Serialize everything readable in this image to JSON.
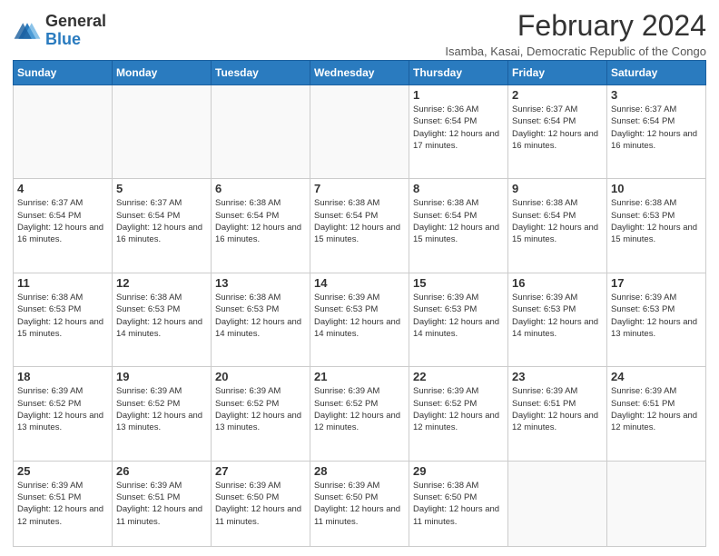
{
  "logo": {
    "general": "General",
    "blue": "Blue"
  },
  "header": {
    "month_year": "February 2024",
    "subtitle": "Isamba, Kasai, Democratic Republic of the Congo"
  },
  "weekdays": [
    "Sunday",
    "Monday",
    "Tuesday",
    "Wednesday",
    "Thursday",
    "Friday",
    "Saturday"
  ],
  "weeks": [
    [
      {
        "day": "",
        "info": ""
      },
      {
        "day": "",
        "info": ""
      },
      {
        "day": "",
        "info": ""
      },
      {
        "day": "",
        "info": ""
      },
      {
        "day": "1",
        "info": "Sunrise: 6:36 AM\nSunset: 6:54 PM\nDaylight: 12 hours and 17 minutes."
      },
      {
        "day": "2",
        "info": "Sunrise: 6:37 AM\nSunset: 6:54 PM\nDaylight: 12 hours and 16 minutes."
      },
      {
        "day": "3",
        "info": "Sunrise: 6:37 AM\nSunset: 6:54 PM\nDaylight: 12 hours and 16 minutes."
      }
    ],
    [
      {
        "day": "4",
        "info": "Sunrise: 6:37 AM\nSunset: 6:54 PM\nDaylight: 12 hours and 16 minutes."
      },
      {
        "day": "5",
        "info": "Sunrise: 6:37 AM\nSunset: 6:54 PM\nDaylight: 12 hours and 16 minutes."
      },
      {
        "day": "6",
        "info": "Sunrise: 6:38 AM\nSunset: 6:54 PM\nDaylight: 12 hours and 16 minutes."
      },
      {
        "day": "7",
        "info": "Sunrise: 6:38 AM\nSunset: 6:54 PM\nDaylight: 12 hours and 15 minutes."
      },
      {
        "day": "8",
        "info": "Sunrise: 6:38 AM\nSunset: 6:54 PM\nDaylight: 12 hours and 15 minutes."
      },
      {
        "day": "9",
        "info": "Sunrise: 6:38 AM\nSunset: 6:54 PM\nDaylight: 12 hours and 15 minutes."
      },
      {
        "day": "10",
        "info": "Sunrise: 6:38 AM\nSunset: 6:53 PM\nDaylight: 12 hours and 15 minutes."
      }
    ],
    [
      {
        "day": "11",
        "info": "Sunrise: 6:38 AM\nSunset: 6:53 PM\nDaylight: 12 hours and 15 minutes."
      },
      {
        "day": "12",
        "info": "Sunrise: 6:38 AM\nSunset: 6:53 PM\nDaylight: 12 hours and 14 minutes."
      },
      {
        "day": "13",
        "info": "Sunrise: 6:38 AM\nSunset: 6:53 PM\nDaylight: 12 hours and 14 minutes."
      },
      {
        "day": "14",
        "info": "Sunrise: 6:39 AM\nSunset: 6:53 PM\nDaylight: 12 hours and 14 minutes."
      },
      {
        "day": "15",
        "info": "Sunrise: 6:39 AM\nSunset: 6:53 PM\nDaylight: 12 hours and 14 minutes."
      },
      {
        "day": "16",
        "info": "Sunrise: 6:39 AM\nSunset: 6:53 PM\nDaylight: 12 hours and 14 minutes."
      },
      {
        "day": "17",
        "info": "Sunrise: 6:39 AM\nSunset: 6:53 PM\nDaylight: 12 hours and 13 minutes."
      }
    ],
    [
      {
        "day": "18",
        "info": "Sunrise: 6:39 AM\nSunset: 6:52 PM\nDaylight: 12 hours and 13 minutes."
      },
      {
        "day": "19",
        "info": "Sunrise: 6:39 AM\nSunset: 6:52 PM\nDaylight: 12 hours and 13 minutes."
      },
      {
        "day": "20",
        "info": "Sunrise: 6:39 AM\nSunset: 6:52 PM\nDaylight: 12 hours and 13 minutes."
      },
      {
        "day": "21",
        "info": "Sunrise: 6:39 AM\nSunset: 6:52 PM\nDaylight: 12 hours and 12 minutes."
      },
      {
        "day": "22",
        "info": "Sunrise: 6:39 AM\nSunset: 6:52 PM\nDaylight: 12 hours and 12 minutes."
      },
      {
        "day": "23",
        "info": "Sunrise: 6:39 AM\nSunset: 6:51 PM\nDaylight: 12 hours and 12 minutes."
      },
      {
        "day": "24",
        "info": "Sunrise: 6:39 AM\nSunset: 6:51 PM\nDaylight: 12 hours and 12 minutes."
      }
    ],
    [
      {
        "day": "25",
        "info": "Sunrise: 6:39 AM\nSunset: 6:51 PM\nDaylight: 12 hours and 12 minutes."
      },
      {
        "day": "26",
        "info": "Sunrise: 6:39 AM\nSunset: 6:51 PM\nDaylight: 12 hours and 11 minutes."
      },
      {
        "day": "27",
        "info": "Sunrise: 6:39 AM\nSunset: 6:50 PM\nDaylight: 12 hours and 11 minutes."
      },
      {
        "day": "28",
        "info": "Sunrise: 6:39 AM\nSunset: 6:50 PM\nDaylight: 12 hours and 11 minutes."
      },
      {
        "day": "29",
        "info": "Sunrise: 6:38 AM\nSunset: 6:50 PM\nDaylight: 12 hours and 11 minutes."
      },
      {
        "day": "",
        "info": ""
      },
      {
        "day": "",
        "info": ""
      }
    ]
  ]
}
